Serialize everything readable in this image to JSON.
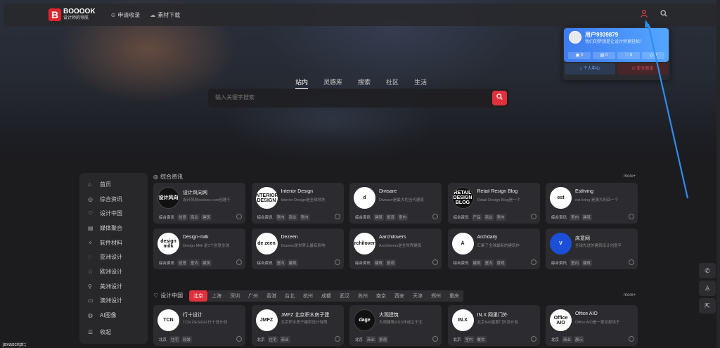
{
  "header": {
    "logo_letter": "B",
    "logo_name": "BOOOOK",
    "logo_sub": "设计师的导航",
    "nav": [
      {
        "icon": "link-icon",
        "label": "申请收录"
      },
      {
        "icon": "cloud-download-icon",
        "label": "素材下载"
      }
    ]
  },
  "user_popover": {
    "name": "用户9939879",
    "signature": "我们的梦想是让设计师更轻松！",
    "stats": [
      "0",
      "0",
      "0",
      "0"
    ],
    "center_label": "个人中心",
    "logout_label": "安全退出"
  },
  "search": {
    "tabs": [
      "站内",
      "灵感库",
      "搜索",
      "社区",
      "生活"
    ],
    "active_tab": "站内",
    "placeholder": "输入关键字搜索"
  },
  "sidebar": {
    "items": [
      {
        "icon": "home-icon",
        "label": "首页"
      },
      {
        "icon": "news-icon",
        "label": "综合资讯"
      },
      {
        "icon": "heart-icon",
        "label": "设计中国"
      },
      {
        "icon": "media-icon",
        "label": "媒体聚合"
      },
      {
        "icon": "material-icon",
        "label": "软件材料"
      },
      {
        "icon": "asia-icon",
        "label": "亚洲设计"
      },
      {
        "icon": "europe-icon",
        "label": "欧洲设计"
      },
      {
        "icon": "america-icon",
        "label": "美洲设计"
      },
      {
        "icon": "oceania-icon",
        "label": "澳洲设计"
      },
      {
        "icon": "ai-icon",
        "label": "AI图像"
      },
      {
        "icon": "collapse-icon",
        "label": "收起"
      }
    ]
  },
  "section1": {
    "title": "综合资讯",
    "more": "more+",
    "cards": [
      {
        "logo": "设计风向",
        "logo_style": "dark",
        "title": "设计风向网",
        "desc": "设计风向socbox.com创建于",
        "tags": [
          "综合资讯",
          "创意",
          "商业",
          "建筑"
        ]
      },
      {
        "logo": "INTERIOR DESIGN",
        "logo_style": "light",
        "title": "Interior Design",
        "desc": "Interior Design是全球领先",
        "tags": [
          "综合资讯",
          "室内",
          "商业",
          "室内"
        ]
      },
      {
        "logo": "d",
        "logo_style": "light",
        "title": "Divisare",
        "desc": "Divisare是最大的当代建筑",
        "tags": [
          "综合资讯",
          "建筑",
          "景观",
          "室内"
        ]
      },
      {
        "logo": "RETAIL DESIGN BLOG",
        "logo_style": "dark",
        "title": "Retail Resign Blog",
        "desc": "Retail Design Blog是一个",
        "tags": [
          "综合资讯",
          "产品",
          "商业",
          "室内"
        ]
      },
      {
        "logo": "est",
        "logo_style": "light",
        "title": "Estliving",
        "desc": "est living 是澳大利亚一个",
        "tags": [
          "综合资讯",
          "室内",
          "建筑"
        ]
      },
      {
        "logo": "design milk",
        "logo_style": "light",
        "title": "Design-milk",
        "desc": "Design Milk 是1个创意全球",
        "tags": [
          "综合资讯",
          "创意",
          "室内",
          "建筑"
        ]
      },
      {
        "logo": "de zeen",
        "logo_style": "light",
        "title": "Dezeen",
        "desc": "Dezeen是世界上最有影响",
        "tags": [
          "综合资讯",
          "室内",
          "建筑"
        ]
      },
      {
        "logo": "archilovers",
        "logo_style": "light",
        "title": "Aarchilovers",
        "desc": "Archilovers是全世界建筑",
        "tags": [
          "综合资讯",
          "建筑",
          "景观"
        ]
      },
      {
        "logo": "A",
        "logo_style": "light",
        "title": "Archdaily",
        "desc": "汇集了全球最新的建筑作",
        "tags": [
          "综合资讯",
          "建筑",
          "室内",
          "景观"
        ]
      },
      {
        "logo": "V",
        "logo_style": "blue",
        "title": "床意网",
        "desc": "全球先进的建筑设计创意平",
        "tags": [
          "综合资讯",
          "室内",
          "建筑"
        ]
      }
    ]
  },
  "section2": {
    "title": "设计中国",
    "more": "more+",
    "cities": [
      "北京",
      "上海",
      "深圳",
      "广州",
      "香港",
      "台北",
      "杭州",
      "成都",
      "武汉",
      "苏州",
      "南京",
      "西安",
      "天津",
      "郑州",
      "重庆"
    ],
    "active_city": "北京",
    "cards": [
      {
        "logo": "TCN",
        "logo_style": "light",
        "title": "行十设计",
        "desc": "TCN DESIGN 行十设计创",
        "tags": [
          "北京",
          "住宅",
          "软装"
        ]
      },
      {
        "logo": "JMFZ",
        "logo_style": "light",
        "title": "JMFZ 北京积木房子建",
        "desc": "北京积木房子建筑设计有限",
        "tags": [
          "北京",
          "住宅",
          "商业"
        ]
      },
      {
        "logo": "dage",
        "logo_style": "dark",
        "title": "大观建筑",
        "desc": "大观建筑2015年成立于北",
        "tags": [
          "北京",
          "商业",
          "景观"
        ]
      },
      {
        "logo": "IN.X",
        "logo_style": "light",
        "title": "IN.X 网里门外",
        "desc": "北京INX屋里门外设计有",
        "tags": [
          "北京",
          "室内",
          "餐饮"
        ]
      },
      {
        "logo": "Office AIO",
        "logo_style": "light",
        "title": "Office AIO",
        "desc": "Office AIO是一家总部设于",
        "tags": [
          "北京",
          "商业",
          "展示"
        ]
      }
    ]
  },
  "float_bar": [
    "wechat-icon",
    "user-icon",
    "share-icon"
  ],
  "status_text": "javascript:;"
}
